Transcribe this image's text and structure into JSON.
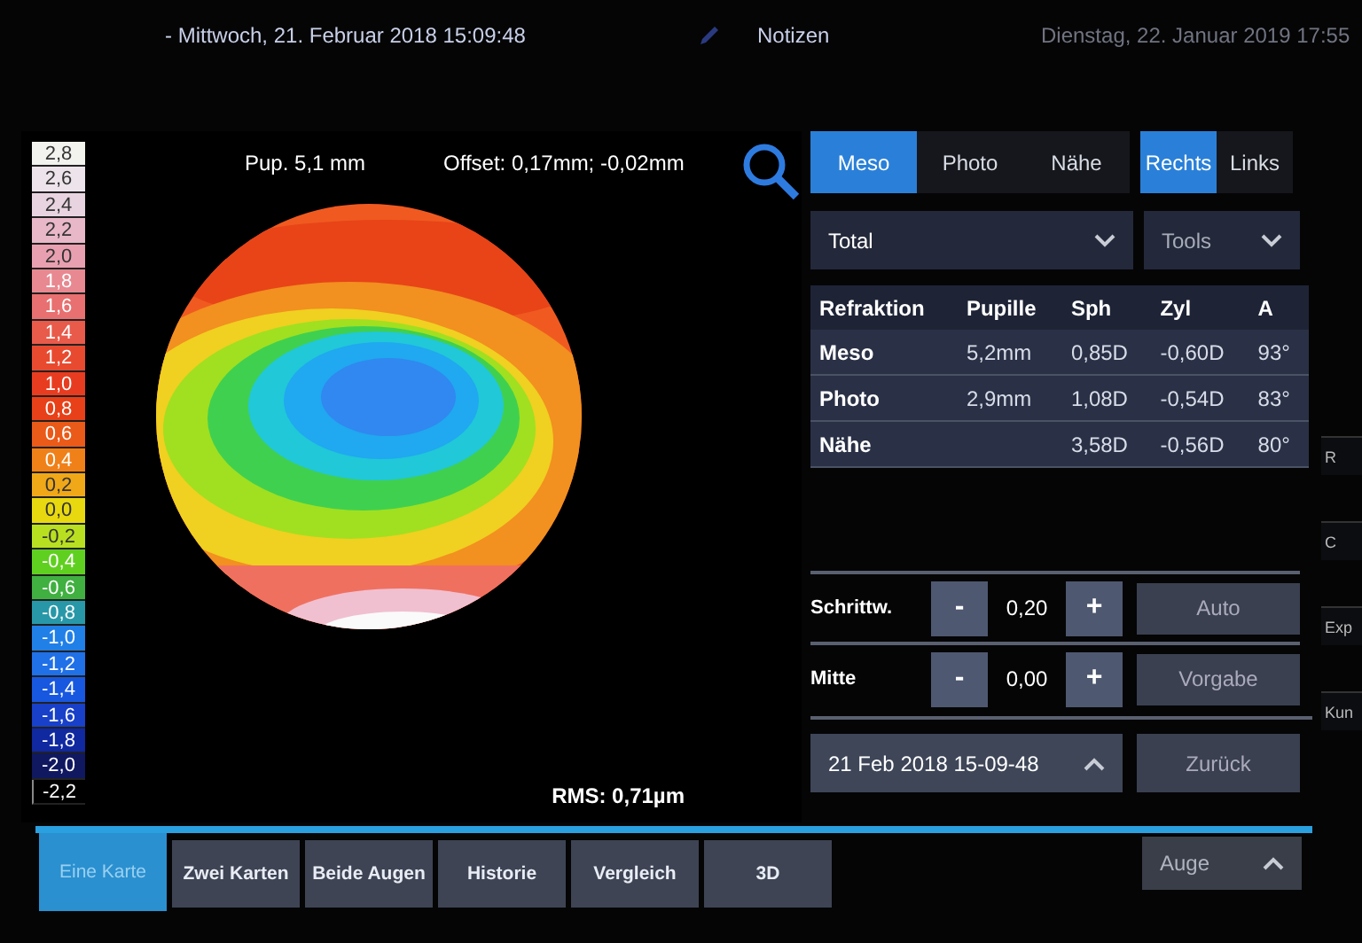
{
  "header": {
    "date": "- Mittwoch, 21. Februar 2018 15:09:48",
    "notes": "Notizen",
    "current_date": "Dienstag, 22. Januar 2019 17:55"
  },
  "scale": [
    {
      "label": "2,8",
      "color": "#f2f2ee"
    },
    {
      "label": "2,6",
      "color": "#ece4ea"
    },
    {
      "label": "2,4",
      "color": "#e8d4e0"
    },
    {
      "label": "2,2",
      "color": "#e8b8c8"
    },
    {
      "label": "2,0",
      "color": "#e8a0b0"
    },
    {
      "label": "1,8",
      "color": "#e88890"
    },
    {
      "label": "1,6",
      "color": "#e87070"
    },
    {
      "label": "1,4",
      "color": "#e85a4a"
    },
    {
      "label": "1,2",
      "color": "#e84a30"
    },
    {
      "label": "1,0",
      "color": "#e83c20"
    },
    {
      "label": "0,8",
      "color": "#e84018"
    },
    {
      "label": "0,6",
      "color": "#ea5a18"
    },
    {
      "label": "0,4",
      "color": "#f08018"
    },
    {
      "label": "0,2",
      "color": "#f0a818"
    },
    {
      "label": "0,0",
      "color": "#e8d810"
    },
    {
      "label": "-0,2",
      "color": "#b8e020"
    },
    {
      "label": "-0,4",
      "color": "#60d020"
    },
    {
      "label": "-0,6",
      "color": "#40b040"
    },
    {
      "label": "-0,8",
      "color": "#2898a8"
    },
    {
      "label": "-1,0",
      "color": "#2080e8"
    },
    {
      "label": "-1,2",
      "color": "#2070e8"
    },
    {
      "label": "-1,4",
      "color": "#1858e0"
    },
    {
      "label": "-1,6",
      "color": "#1840c8"
    },
    {
      "label": "-1,8",
      "color": "#1028a0"
    },
    {
      "label": "-2,0",
      "color": "#101860"
    },
    {
      "label": "-2,2",
      "color": "#000000"
    }
  ],
  "map": {
    "pupil": "Pup. 5,1 mm",
    "offset": "Offset: 0,17mm; -0,02mm",
    "rms": "RMS: 0,71µm"
  },
  "mode_tabs": [
    {
      "label": "Meso",
      "selected": true
    },
    {
      "label": "Photo",
      "selected": false
    },
    {
      "label": "Nähe",
      "selected": false
    }
  ],
  "eye_tabs": [
    {
      "label": "Rechts",
      "selected": true
    },
    {
      "label": "Links",
      "selected": false
    }
  ],
  "view_dropdown": {
    "value": "Total"
  },
  "tools_dropdown": {
    "value": "Tools"
  },
  "table": {
    "columns": [
      "Refraktion",
      "Pupille",
      "Sph",
      "Zyl",
      "A"
    ],
    "rows": [
      [
        "Meso",
        "5,2mm",
        "0,85D",
        "-0,60D",
        "93°"
      ],
      [
        "Photo",
        "2,9mm",
        "1,08D",
        "-0,54D",
        "83°"
      ],
      [
        "Nähe",
        "",
        "3,58D",
        "-0,56D",
        "80°"
      ]
    ]
  },
  "controls": [
    {
      "label": "Schrittw.",
      "minus": "-",
      "value": "0,20",
      "plus": "+",
      "button": "Auto"
    },
    {
      "label": "Mitte",
      "minus": "-",
      "value": "0,00",
      "plus": "+",
      "button": "Vorgabe"
    }
  ],
  "exam_dropdown": {
    "value": "21 Feb 2018 15-09-48"
  },
  "back_button": "Zurück",
  "view_tabs": [
    {
      "label": "Eine Karte",
      "selected": true
    },
    {
      "label": "Zwei Karten",
      "selected": false
    },
    {
      "label": "Beide Augen",
      "selected": false
    },
    {
      "label": "Historie",
      "selected": false
    },
    {
      "label": "Vergleich",
      "selected": false
    },
    {
      "label": "3D",
      "selected": false
    }
  ],
  "eye_dropdown": {
    "value": "Auge"
  },
  "edge_buttons": [
    "R",
    "C",
    "Exp",
    "Kun"
  ]
}
